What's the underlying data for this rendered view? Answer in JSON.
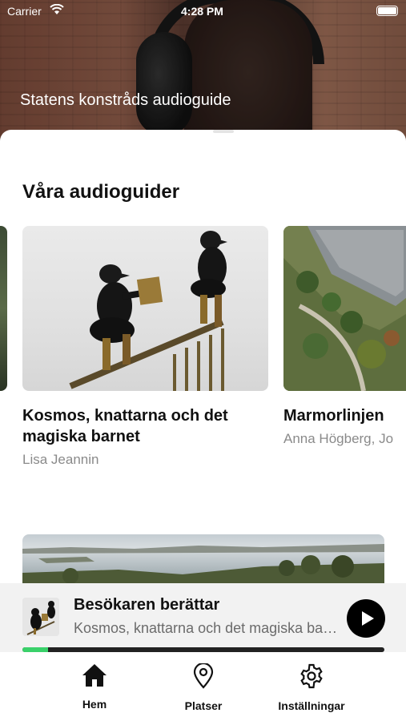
{
  "status_bar": {
    "carrier": "Carrier",
    "time": "4:28 PM"
  },
  "hero": {
    "title": "Statens konstråds audioguide"
  },
  "section": {
    "title": "Våra audioguider"
  },
  "guides": [
    {
      "name": "Kosmos, knattarna och det magiska barnet",
      "author": "Lisa Jeannin"
    },
    {
      "name": "Marmorlinjen",
      "author": "Anna Högberg, Jo"
    }
  ],
  "player": {
    "title": "Besökaren berättar",
    "subtitle": "Kosmos, knattarna och det magiska barnet",
    "progress": 0.07,
    "progress_color": "#3ad16a"
  },
  "tabs": [
    {
      "label": "Hem",
      "icon": "home-icon"
    },
    {
      "label": "Platser",
      "icon": "location-pin-icon"
    },
    {
      "label": "Inställningar",
      "icon": "gear-icon"
    }
  ]
}
